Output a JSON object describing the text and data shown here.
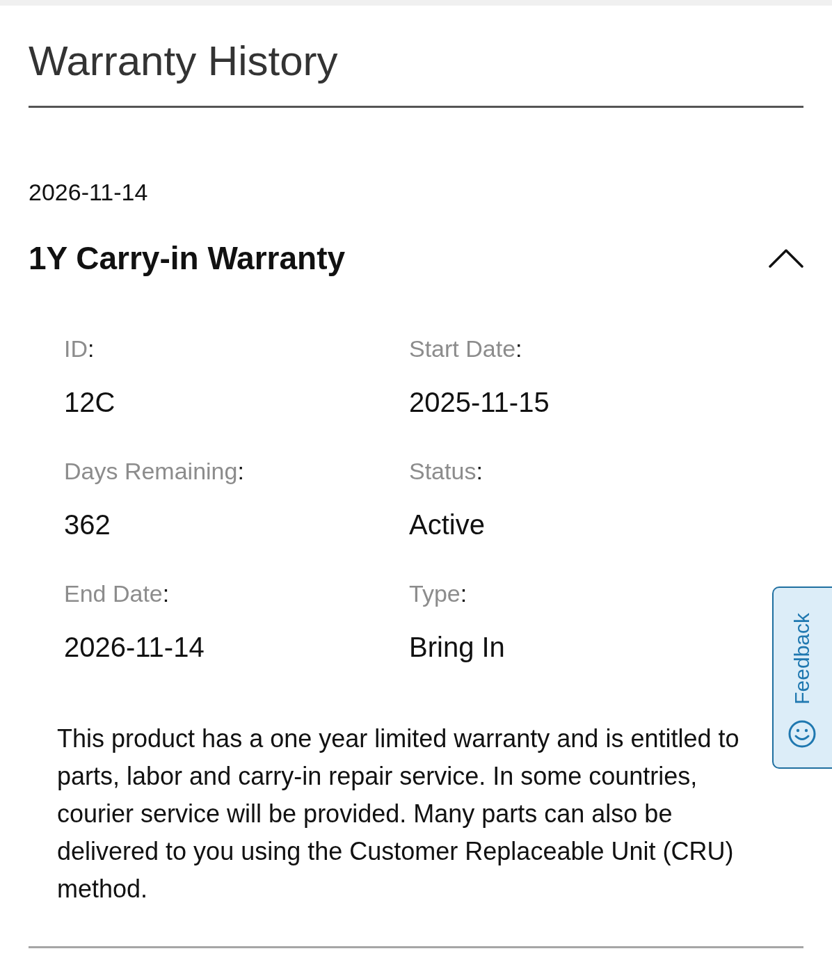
{
  "title": "Warranty History",
  "warranties": [
    {
      "date": "2026-11-14",
      "name": "1Y Carry-in Warranty",
      "expanded": true,
      "details": [
        {
          "label": "ID",
          "colon": ":",
          "value": "12C"
        },
        {
          "label": "Start Date",
          "colon": ":",
          "value": "2025-11-15"
        },
        {
          "label": "Days Remaining",
          "colon": ":",
          "value": "362"
        },
        {
          "label": "Status",
          "colon": ":",
          "value": "Active"
        },
        {
          "label": "End Date",
          "colon": ":",
          "value": "2026-11-14"
        },
        {
          "label": "Type",
          "colon": ":",
          "value": "Bring In"
        }
      ],
      "description": "This product has a one year limited warranty and is entitled to parts, labor and carry-in repair service. In some countries, courier service will be provided. Many parts can also be delivered to you using the Customer Replaceable Unit (CRU) method."
    }
  ],
  "feedback": {
    "label": "Feedback"
  }
}
